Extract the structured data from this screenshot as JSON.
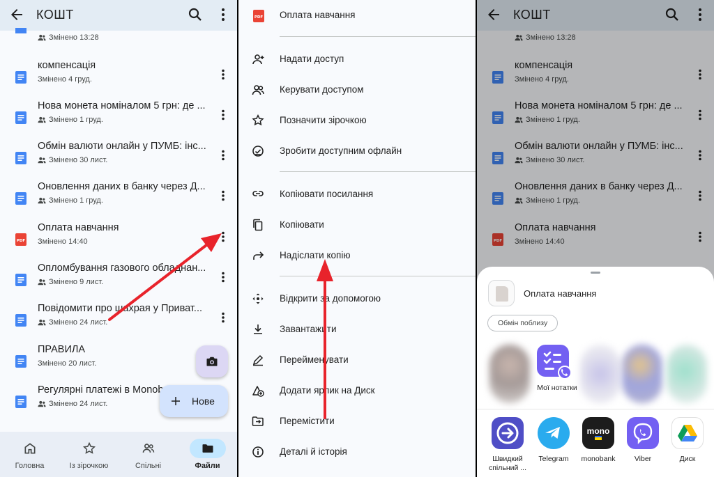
{
  "left": {
    "title": "КОШТ",
    "files": [
      {
        "name": "",
        "meta": "Змінено 13:28",
        "type": "doc",
        "shared": true
      },
      {
        "name": "компенсація",
        "meta": "Змінено 4 груд.",
        "type": "doc",
        "shared": false
      },
      {
        "name": "Нова монета номіналом 5 грн: де ...",
        "meta": "Змінено 1 груд.",
        "type": "doc",
        "shared": true
      },
      {
        "name": "Обмін валюти онлайн у ПУМБ: інс...",
        "meta": "Змінено 30 лист.",
        "type": "doc",
        "shared": true
      },
      {
        "name": "Оновлення даних в банку через Д...",
        "meta": "Змінено 1 груд.",
        "type": "doc",
        "shared": true
      },
      {
        "name": "Оплата навчання",
        "meta": "Змінено 14:40",
        "type": "pdf",
        "shared": false
      },
      {
        "name": "Опломбування газового обладнан...",
        "meta": "Змінено 9 лист.",
        "type": "doc",
        "shared": true
      },
      {
        "name": "Повідомити про шахрая у Приват...",
        "meta": "Змінено 24 лист.",
        "type": "doc",
        "shared": true
      },
      {
        "name": "ПРАВИЛА",
        "meta": "Змінено 20 лист.",
        "type": "doc",
        "shared": false
      },
      {
        "name": "Регулярні платежі в Monob",
        "meta": "Змінено 24 лист.",
        "type": "doc",
        "shared": true
      }
    ],
    "fab_new": "Нове",
    "nav": [
      "Головна",
      "Із зірочкою",
      "Спільні",
      "Файли"
    ],
    "pdf_badge": "PDF"
  },
  "menu": {
    "header": "Оплата навчання",
    "items": [
      "Надати доступ",
      "Керувати доступом",
      "Позначити зірочкою",
      "Зробити доступним офлайн",
      "Копіювати посилання",
      "Копіювати",
      "Надіслати копію",
      "Відкрити за допомогою",
      "Завантажити",
      "Перейменувати",
      "Додати ярлик на Диск",
      "Перемістити",
      "Деталі й історія"
    ]
  },
  "right": {
    "title": "КОШТ",
    "files": [
      {
        "meta": "Змінено 13:28"
      },
      {
        "name": "компенсація",
        "meta": "Змінено 4 груд."
      },
      {
        "name": "Нова монета номіналом 5 грн: де ...",
        "meta": "Змінено 1 груд."
      },
      {
        "name": "Обмін валюти онлайн у ПУМБ: інс...",
        "meta": "Змінено 30 лист."
      },
      {
        "name": "Оновлення даних в банку через Д...",
        "meta": "Змінено 1 груд."
      },
      {
        "name": "Оплата навчання",
        "meta": "Змінено 14:40"
      }
    ],
    "share": {
      "file_name": "Оплата навчання",
      "nearby": "Обмін поблизу",
      "contact_label": "Мої нотатки",
      "apps": [
        "Швидкий спільний ...",
        "Telegram",
        "monobank",
        "Viber",
        "Диск"
      ],
      "mono_text": "mono"
    }
  },
  "colors": {
    "accent_blue": "#4285f4",
    "pdf_red": "#ea4335",
    "arrow_red": "#e8232b",
    "viber": "#7360f2",
    "telegram": "#2aabee"
  }
}
